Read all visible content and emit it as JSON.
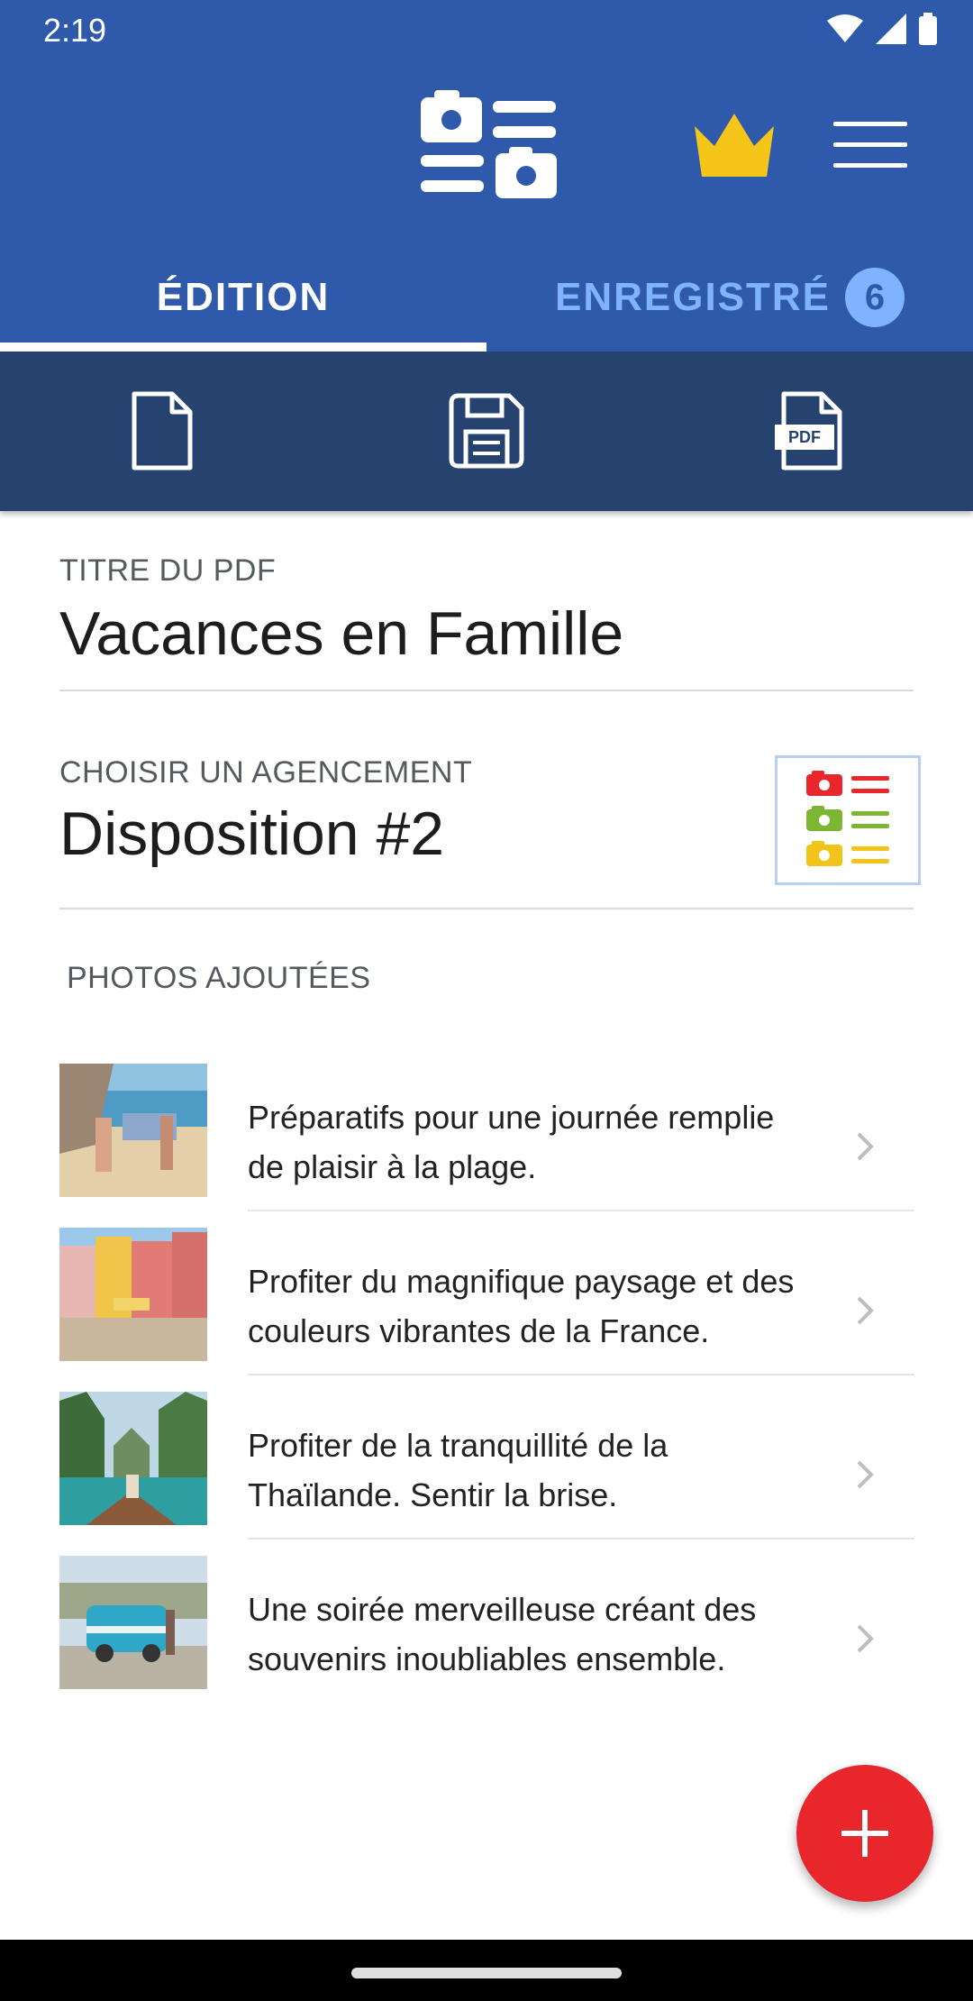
{
  "status_bar": {
    "time": "2:19"
  },
  "tabs": [
    {
      "label": "ÉDITION"
    },
    {
      "label": "ENREGISTRÉ",
      "badge": "6"
    }
  ],
  "toolbar": {
    "items": [
      {
        "icon": "new-page-icon"
      },
      {
        "icon": "save-icon"
      },
      {
        "icon": "pdf-icon",
        "text": "PDF"
      }
    ]
  },
  "pdf_title": {
    "label": "TITRE DU PDF",
    "value": "Vacances en Famille"
  },
  "layout": {
    "label": "CHOISIR UN AGENCEMENT",
    "value": "Disposition #2"
  },
  "photos": {
    "label": "PHOTOS AJOUTÉES",
    "items": [
      {
        "line1": "Préparatifs pour une journée remplie",
        "line2": "de plaisir à la plage."
      },
      {
        "line1": "Profiter du magnifique paysage et des",
        "line2": "couleurs vibrantes de la France."
      },
      {
        "line1": "Profiter de la tranquillité de la",
        "line2": "Thaïlande. Sentir la brise."
      },
      {
        "line1": "Une soirée merveilleuse créant des",
        "line2": "souvenirs inoubliables ensemble."
      }
    ]
  },
  "colors": {
    "header": "#2F5AAB",
    "toolbar": "#264370",
    "tab_inactive": "#7FB3FF",
    "crown": "#F5C518",
    "fab": "#E8262C"
  }
}
